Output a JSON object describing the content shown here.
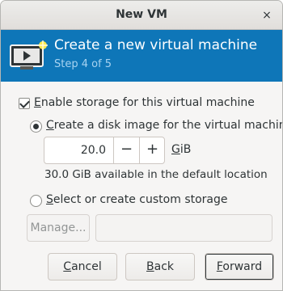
{
  "window": {
    "title": "New VM",
    "close_glyph": "×"
  },
  "banner": {
    "title": "Create a new virtual machine",
    "step": "Step 4 of 5",
    "icon": "virtual-machine-icon",
    "bg_color": "#0e76b8"
  },
  "storage": {
    "enable_label_prefix": "E",
    "enable_label_rest": "nable storage for this virtual machine",
    "enable_checked": true,
    "create_label_prefix": "C",
    "create_label_rest": "reate a disk image for the virtual machine",
    "create_selected": true,
    "size_value": "20.0",
    "decrement": "−",
    "increment": "+",
    "unit_prefix": "G",
    "unit_rest": "iB",
    "available_text": "30.0 GiB available in the default location",
    "custom_label_prefix": "S",
    "custom_label_rest": "elect or create custom storage",
    "custom_selected": false,
    "manage_label": "Manage...",
    "custom_path_value": ""
  },
  "buttons": {
    "cancel_prefix": "C",
    "cancel_rest": "ancel",
    "back_prefix": "B",
    "back_rest": "ack",
    "forward_prefix": "F",
    "forward_rest": "orward"
  }
}
